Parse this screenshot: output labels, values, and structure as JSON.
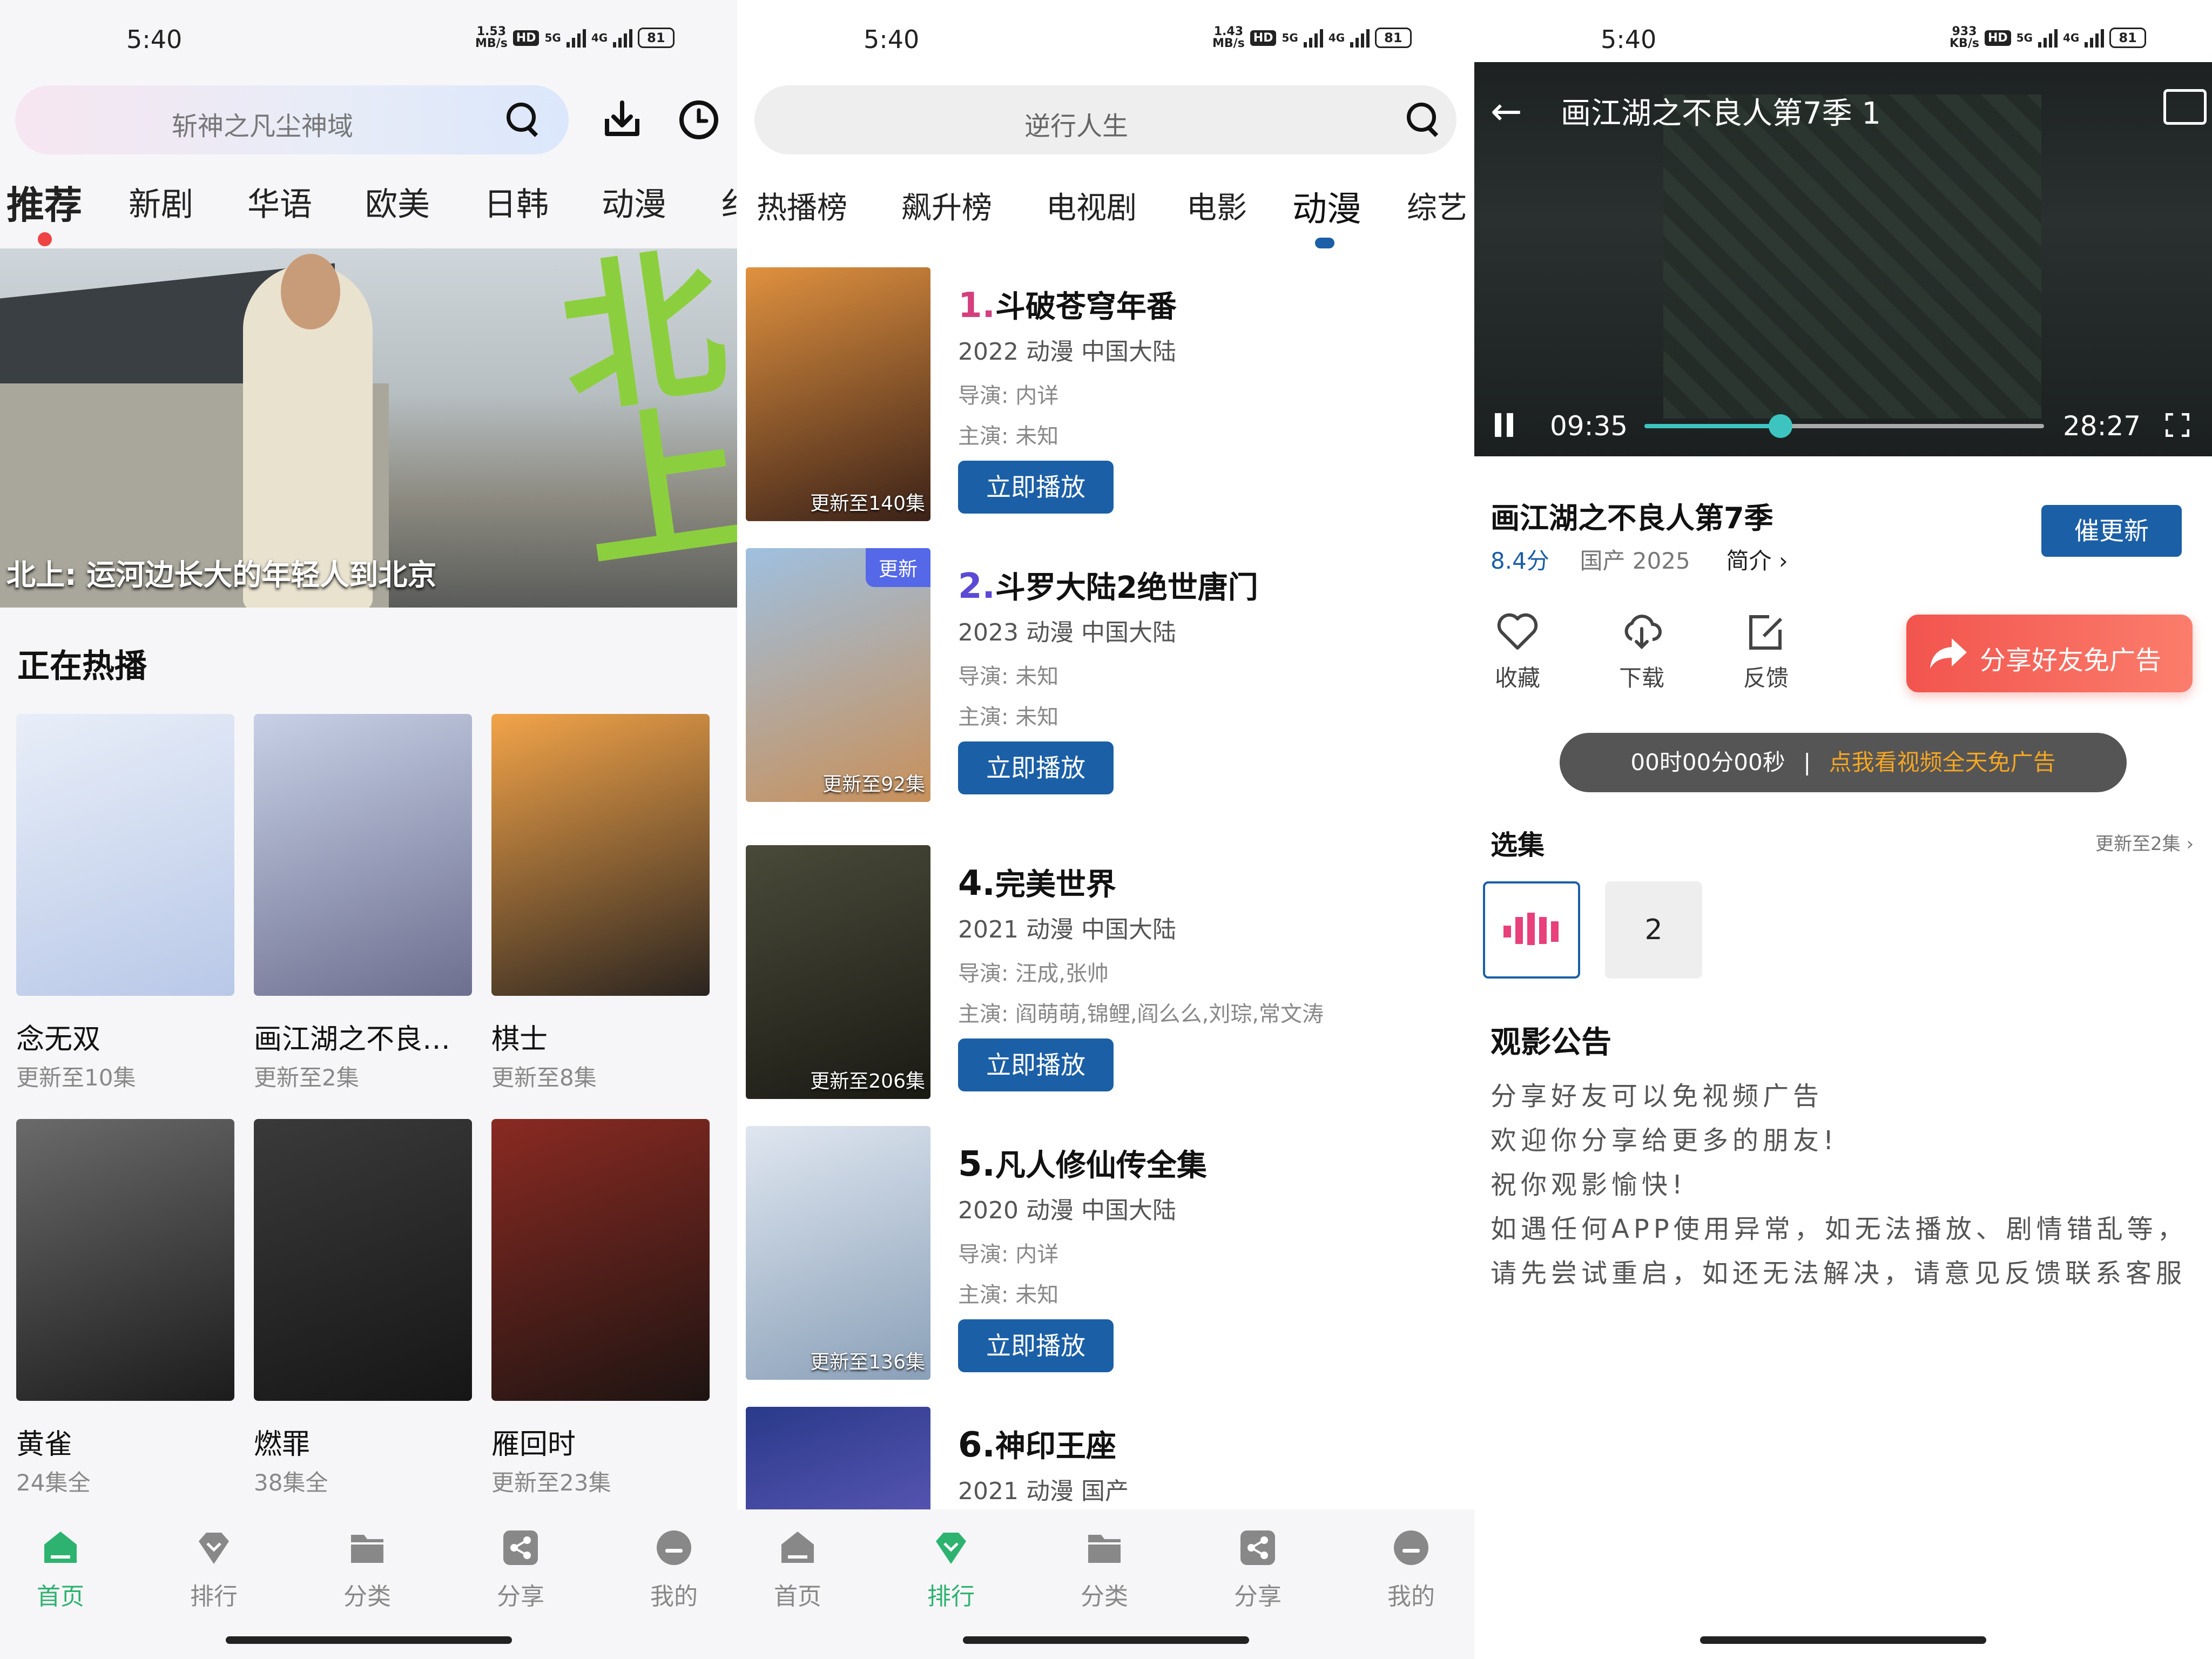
{
  "status": {
    "time": "5:40",
    "screens": [
      {
        "speed_top": "1.53",
        "speed_unit": "MB/s",
        "battery": "81"
      },
      {
        "speed_top": "1.43",
        "speed_unit": "MB/s",
        "battery": "81"
      },
      {
        "speed_top": "933",
        "speed_unit": "KB/s",
        "battery": "81"
      }
    ],
    "hd": "HD",
    "net5g": "5G",
    "net4g": "4G"
  },
  "home": {
    "search_placeholder": "斩神之凡尘神域",
    "tabs": [
      "推荐",
      "新剧",
      "华语",
      "欧美",
      "日韩",
      "动漫",
      "纟"
    ],
    "banner_caption": "北上: 运河边长大的年轻人到北京",
    "banner_calligraphy": "北上",
    "section_title": "正在热播",
    "posters": [
      {
        "title": "念无双",
        "sub": "更新至10集",
        "c1": "#e8eef8",
        "c2": "#b9c8e8"
      },
      {
        "title": "画江湖之不良…",
        "sub": "更新至2集",
        "c1": "#c7d0e6",
        "c2": "#6d6f8f"
      },
      {
        "title": "棋士",
        "sub": "更新至8集",
        "c1": "#f3a449",
        "c2": "#2a2420"
      },
      {
        "title": "黄雀",
        "sub": "24集全",
        "c1": "#6a6a6a",
        "c2": "#1c1c1c"
      },
      {
        "title": "燃罪",
        "sub": "38集全",
        "c1": "#3a3a3a",
        "c2": "#161616"
      },
      {
        "title": "雁回时",
        "sub": "更新至23集",
        "c1": "#8a2a22",
        "c2": "#1d1412"
      }
    ]
  },
  "rank": {
    "search_placeholder": "逆行人生",
    "tabs": [
      "热播榜",
      "飙升榜",
      "电视剧",
      "电影",
      "动漫",
      "综艺"
    ],
    "play_label": "立即播放",
    "items": [
      {
        "num": "1.",
        "num_color": "#d43f7d",
        "title": "斗破苍穹年番",
        "meta": "2022  动漫  中国大陆",
        "director": "导演: 内详",
        "cast": "主演: 未知",
        "badge": "更新至140集",
        "tag": "",
        "c1": "#e0913f",
        "c2": "#3a2118"
      },
      {
        "num": "2.",
        "num_color": "#5b49d6",
        "title": "斗罗大陆2绝世唐门",
        "meta": "2023  动漫  中国大陆",
        "director": "导演: 未知",
        "cast": "主演: 未知",
        "badge": "更新至92集",
        "tag": "更新",
        "c1": "#9fc0e0",
        "c2": "#c8905a"
      },
      {
        "num": "4.",
        "num_color": "#111111",
        "title": "完美世界",
        "meta": "2021  动漫  中国大陆",
        "director": "导演: 汪成,张帅",
        "cast": "主演: 阎萌萌,锦鲤,阎么么,刘琮,常文涛",
        "badge": "更新至206集",
        "tag": "",
        "c1": "#4a4a3a",
        "c2": "#1a1a14"
      },
      {
        "num": "5.",
        "num_color": "#111111",
        "title": "凡人修仙传全集",
        "meta": "2020  动漫  中国大陆",
        "director": "导演: 内详",
        "cast": "主演: 未知",
        "badge": "更新至136集",
        "tag": "",
        "c1": "#dfe6f0",
        "c2": "#8aa0b8"
      },
      {
        "num": "6.",
        "num_color": "#111111",
        "title": "神印王座",
        "meta": "2021  动漫  国产",
        "director": "",
        "cast": "",
        "badge": "",
        "tag": "",
        "c1": "#2a3a8a",
        "c2": "#7a6ad0"
      }
    ]
  },
  "player": {
    "title": "画江湖之不良人第7季 1",
    "current": "09:35",
    "duration": "28:27",
    "progress": 0.34,
    "show_title": "画江湖之不良人第7季",
    "score": "8.4分",
    "region_year": "国产  2025",
    "intro": "简介 ›",
    "remind": "催更新",
    "actions": [
      "收藏",
      "下载",
      "反馈"
    ],
    "share": "分享好友免广告",
    "ad_timer": "00时00分00秒",
    "ad_sep": "|",
    "ad_link": "点我看视频全天免广告",
    "episodes_title": "选集",
    "episodes_update": "更新至2集 ›",
    "episode_2": "2",
    "notice_title": "观影公告",
    "notice_lines": [
      "分享好友可以免视频广告",
      "欢迎你分享给更多的朋友!",
      "祝你观影愉快!",
      "如遇任何APP使用异常，如无法播放、剧情错乱等，",
      "请先尝试重启，如还无法解决，请意见反馈联系客服"
    ]
  },
  "nav": [
    "首页",
    "排行",
    "分类",
    "分享",
    "我的"
  ],
  "colors": {
    "accent": "#1b5fa6",
    "nav_active": "#2db36f",
    "cyan": "#3ec4c0",
    "red": "#f2544e"
  }
}
